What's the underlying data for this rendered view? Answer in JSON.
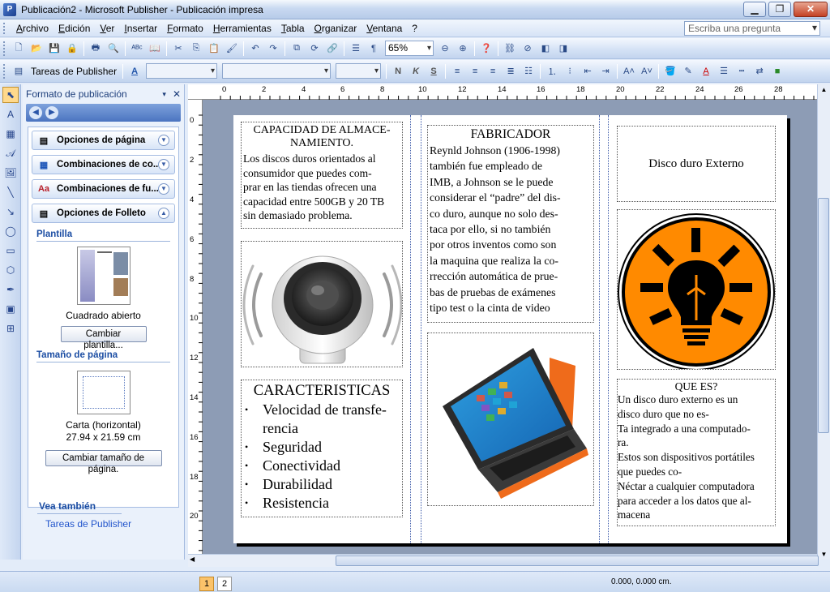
{
  "window": {
    "title": "Publicación2 - Microsoft Publisher  -  Publicación impresa"
  },
  "menu": [
    "Archivo",
    "Edición",
    "Ver",
    "Insertar",
    "Formato",
    "Herramientas",
    "Tabla",
    "Organizar",
    "Ventana",
    "?"
  ],
  "ask_placeholder": "Escriba una pregunta",
  "zoom": "65%",
  "tasks_button": "Tareas de Publisher",
  "format_buttons": {
    "bold": "N",
    "italic": "K",
    "underline": "S"
  },
  "taskpane": {
    "title": "Formato de publicación",
    "sections": [
      {
        "label": "Opciones de página",
        "chevron": "expand"
      },
      {
        "label": "Combinaciones de co...",
        "chevron": "expand"
      },
      {
        "label": "Combinaciones de fu...",
        "chevron": "expand"
      },
      {
        "label": "Opciones de Folleto",
        "chevron": "collapse"
      }
    ],
    "plantilla_label": "Plantilla",
    "plantilla_name": "Cuadrado abierto",
    "change_template": "Cambiar plantilla...",
    "tamano_label": "Tamaño de página",
    "size_name": "Carta (horizontal)",
    "size_dims": "27.94 x 21.59 cm",
    "change_size": "Cambiar tamaño de página.",
    "see_also": "Vea también",
    "see_also_link": "Tareas de Publisher"
  },
  "ruler_h": [
    "0",
    "2",
    "4",
    "6",
    "8",
    "10",
    "12",
    "14",
    "16",
    "18",
    "20",
    "22",
    "24",
    "26",
    "28"
  ],
  "ruler_v": [
    "0",
    "2",
    "4",
    "6",
    "8",
    "10",
    "12",
    "14",
    "16",
    "18",
    "20"
  ],
  "doc": {
    "capacidad_title": "CAPACIDAD DE ALMACE-NAMIENTO.",
    "capacidad_lines": [
      "Los discos duros orientados al",
      "consumidor que puedes com-",
      "prar en las tiendas ofrecen una",
      "capacidad entre 500GB y 20 TB",
      "sin demasiado problema."
    ],
    "caracteristicas_title": "CARACTERISTICAS",
    "caracteristicas_items": [
      "Velocidad de transfe-rencia",
      "Seguridad",
      "Conectividad",
      "Durabilidad",
      "Resistencia"
    ],
    "fabricador_title": "FABRICADOR",
    "fabricador_lines": [
      "Reynld Johnson (1906-1998)",
      "también fue empleado de",
      "IMB, a Johnson se le puede",
      "considerar el “padre” del dis-",
      "co duro, aunque no solo des-",
      "taca por ello, si no también",
      "por otros inventos como son",
      "la maquina que realiza la co-",
      "rrección automática de prue-",
      "bas de pruebas de exámenes",
      "tipo test o la cinta de video"
    ],
    "disco_title": "Disco duro Externo",
    "quees_title": "QUE ES?",
    "quees_lines": [
      "Un disco duro externo es un",
      "disco duro que no es-",
      "Ta integrado a una computado-",
      "ra.",
      "Estos son dispositivos portátiles",
      "que puedes co-",
      "Néctar a cualquier computadora",
      "para acceder a los datos que al-",
      "macena"
    ]
  },
  "status": {
    "pages": [
      "1",
      "2"
    ],
    "current_page": "1",
    "coords": "0.000, 0.000 cm."
  },
  "colors": {
    "orange": "#ff8a00",
    "accent_blue": "#1b4da3"
  }
}
